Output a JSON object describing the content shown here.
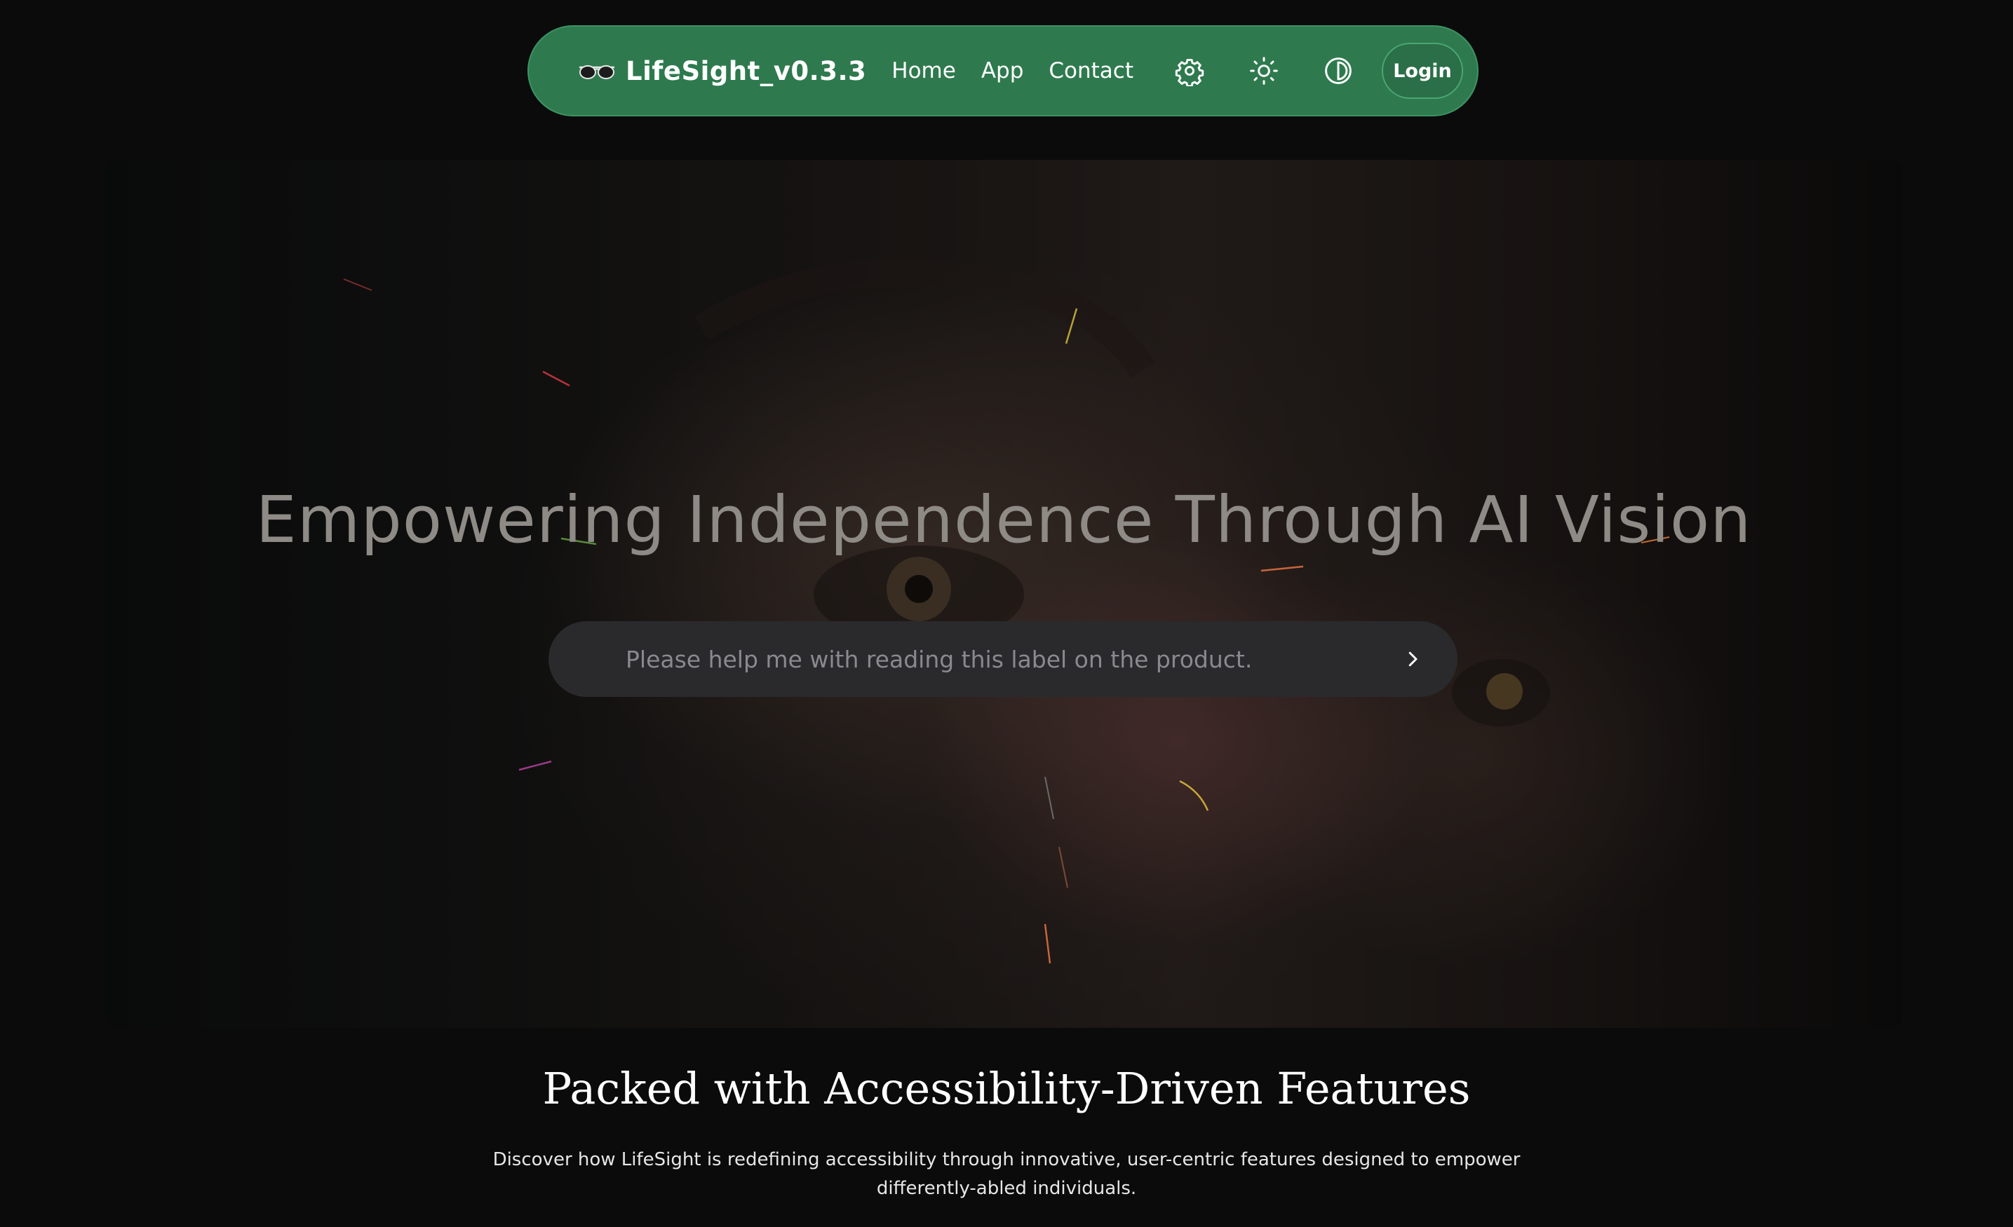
{
  "nav": {
    "brand_icon": "sunglasses-icon",
    "brand_name": "LifeSight_v0.3.3",
    "links": [
      {
        "label": "Home"
      },
      {
        "label": "App"
      },
      {
        "label": "Contact"
      }
    ],
    "icons": [
      "gear-icon",
      "sun-icon",
      "contrast-icon"
    ],
    "login_label": "Login",
    "accent_color": "#2e7a4e"
  },
  "hero": {
    "title": "Empowering Independence Through AI Vision",
    "search": {
      "placeholder": "Please help me with reading this label on the product.",
      "submit_icon": "chevron-right-icon"
    }
  },
  "features": {
    "heading": "Packed with Accessibility-Driven Features",
    "description": "Discover how LifeSight is redefining accessibility through innovative, user-centric features designed to empower differently-abled individuals."
  }
}
